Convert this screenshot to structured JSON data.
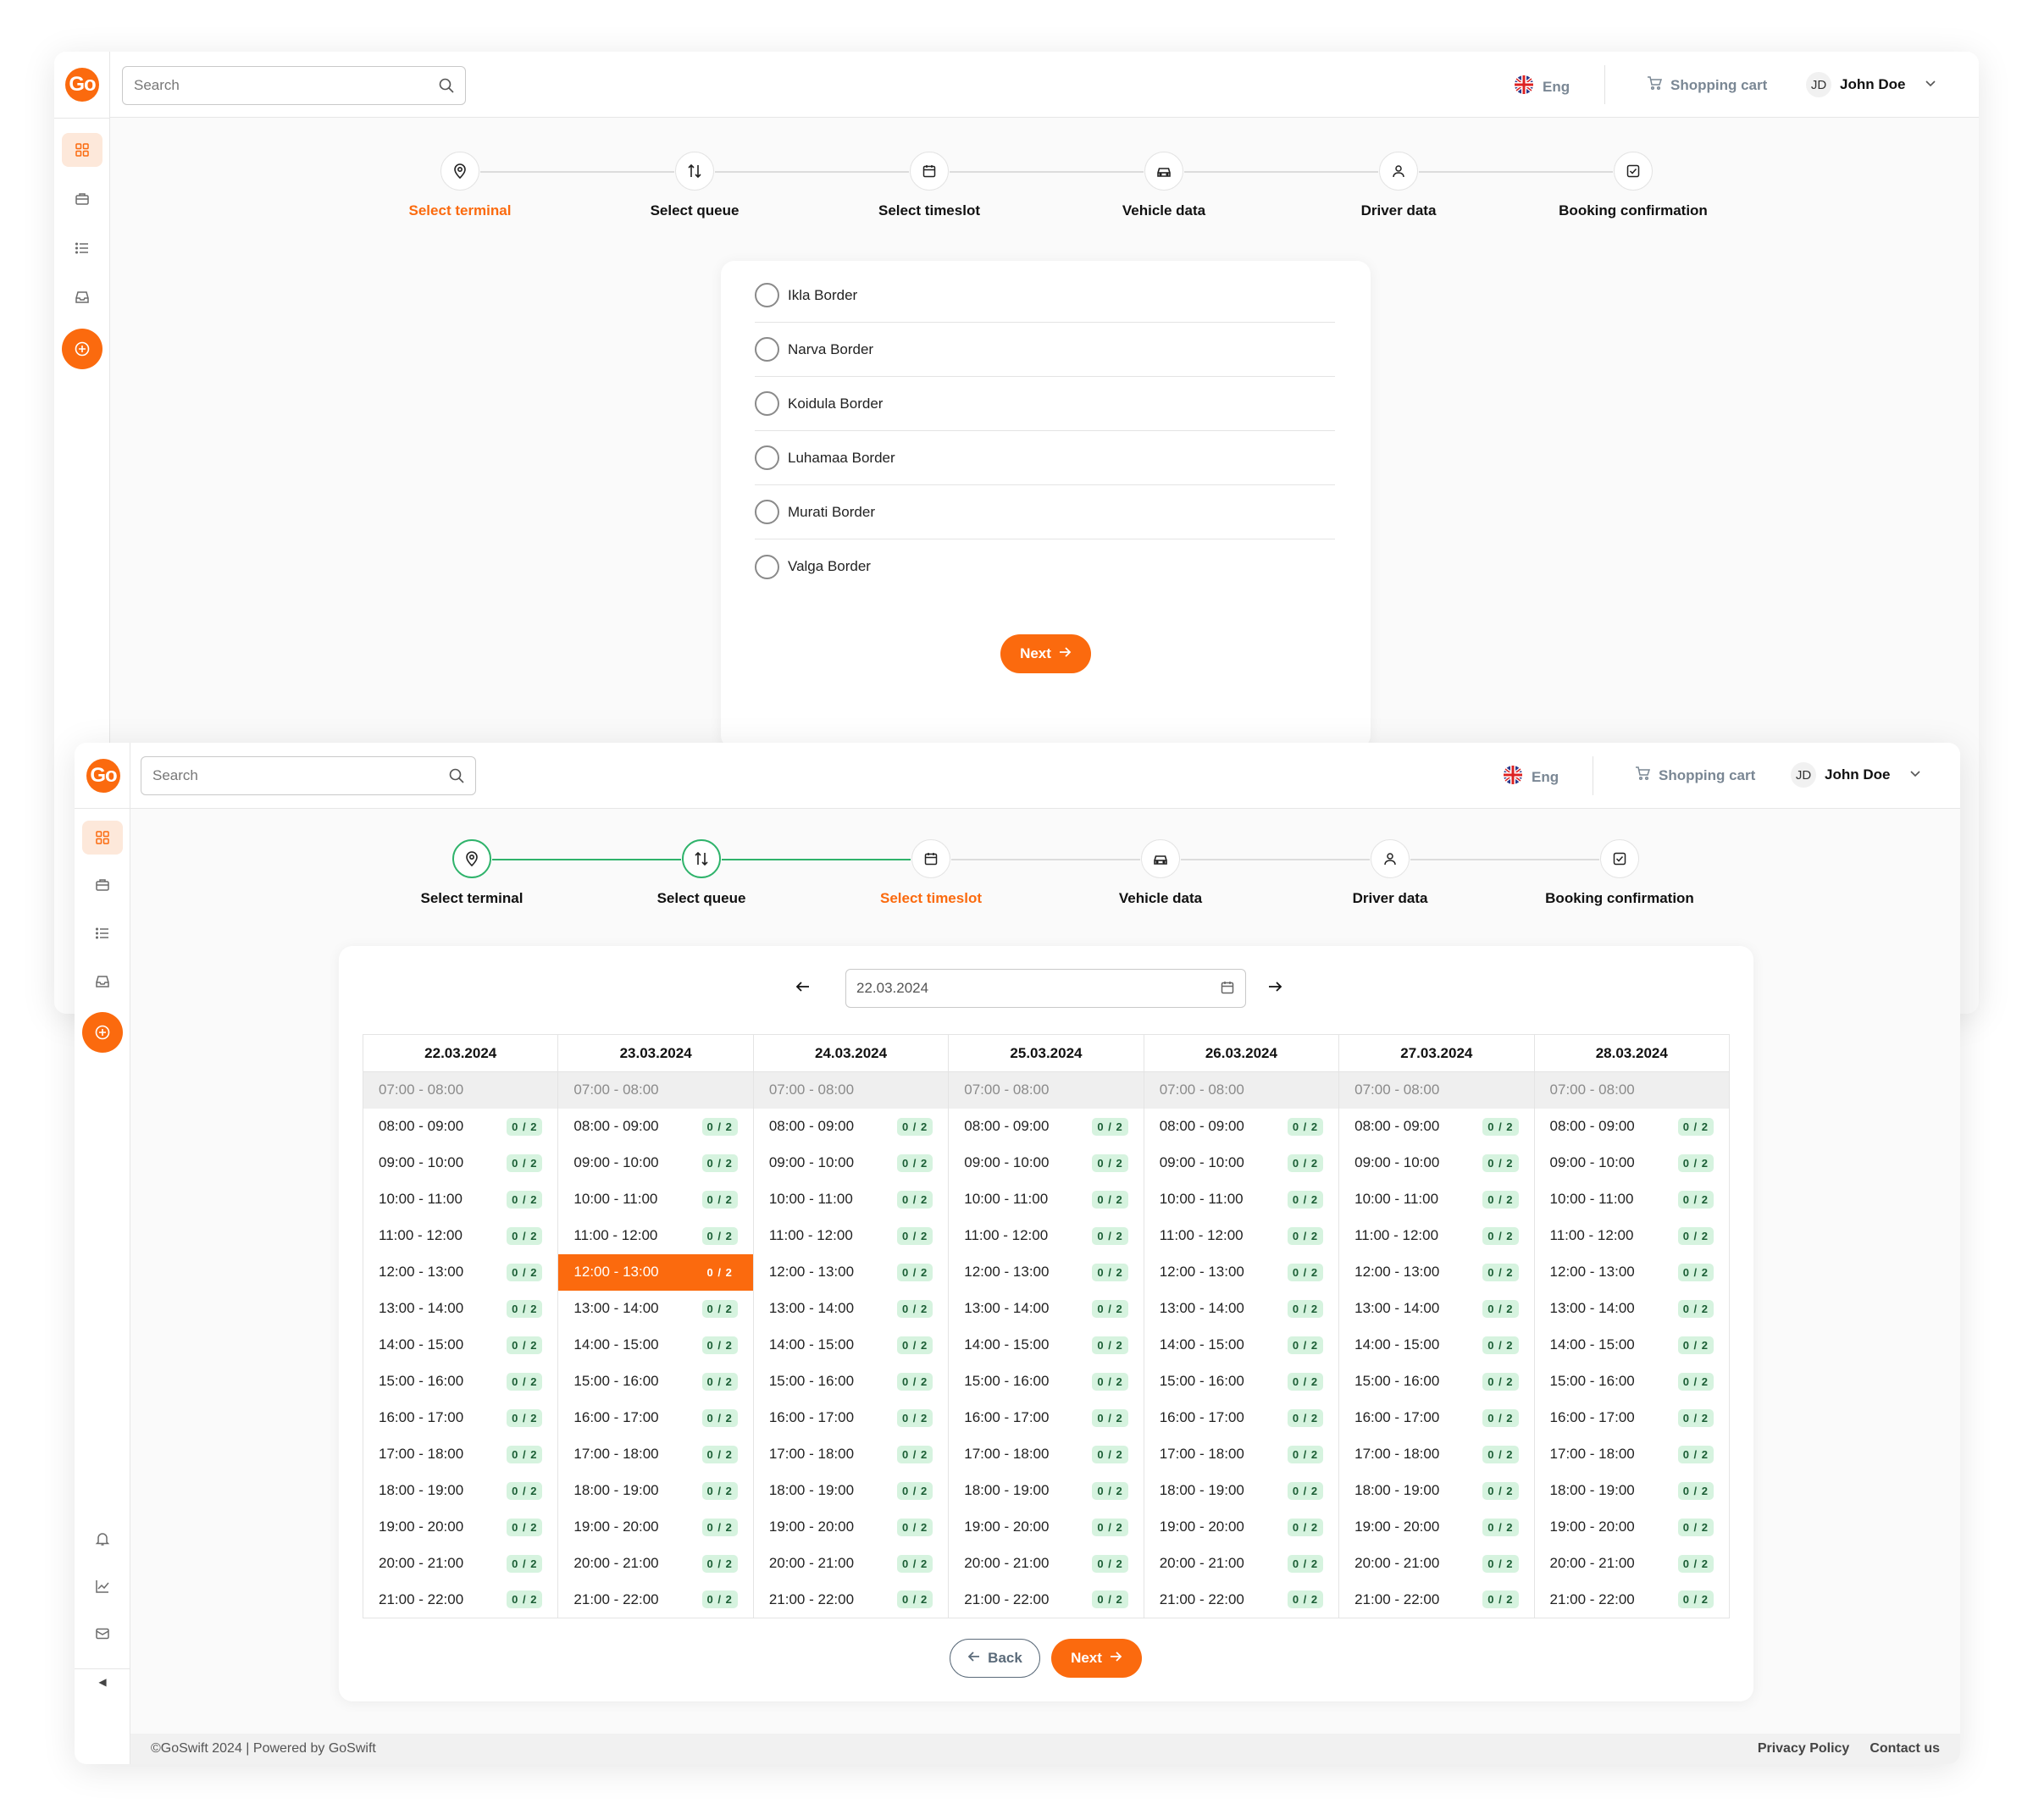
{
  "brand": {
    "logo_text": "Go",
    "accent": "#fb6a0e",
    "success": "#2fb36b"
  },
  "topbar": {
    "search_placeholder": "Search",
    "language": "Eng",
    "cart": "Shopping cart",
    "user_initials": "JD",
    "user_name": "John Doe"
  },
  "sidebar": {
    "items": [
      "dashboard-icon",
      "briefcase-icon",
      "list-icon",
      "inbox-icon",
      "add-icon"
    ],
    "bottom_items": [
      "bell-icon",
      "chart-icon",
      "mail-icon"
    ]
  },
  "steps": [
    {
      "label": "Select terminal",
      "icon": "map-pin-icon"
    },
    {
      "label": "Select queue",
      "icon": "sort-arrows-icon"
    },
    {
      "label": "Select timeslot",
      "icon": "calendar-icon"
    },
    {
      "label": "Vehicle data",
      "icon": "car-icon"
    },
    {
      "label": "Driver data",
      "icon": "user-icon"
    },
    {
      "label": "Booking confirmation",
      "icon": "checkbox-icon"
    }
  ],
  "terminal_screen": {
    "active_step": 0,
    "terminals": [
      "Ikla Border",
      "Narva Border",
      "Koidula Border",
      "Luhamaa Border",
      "Murati Border",
      "Valga Border"
    ],
    "next_label": "Next"
  },
  "timeslot_screen": {
    "active_step": 2,
    "date_value": "22.03.2024",
    "dates": [
      "22.03.2024",
      "23.03.2024",
      "24.03.2024",
      "25.03.2024",
      "26.03.2024",
      "27.03.2024",
      "28.03.2024"
    ],
    "disabled_slot": "07:00 - 08:00",
    "slots": [
      "08:00 - 09:00",
      "09:00 - 10:00",
      "10:00 - 11:00",
      "11:00 - 12:00",
      "12:00 - 13:00",
      "13:00 - 14:00",
      "14:00 - 15:00",
      "15:00 - 16:00",
      "16:00 - 17:00",
      "17:00 - 18:00",
      "18:00 - 19:00",
      "19:00 - 20:00",
      "20:00 - 21:00",
      "21:00 - 22:00"
    ],
    "capacity": "0 / 2",
    "selected": {
      "date": "23.03.2024",
      "slot": "12:00 - 13:00"
    },
    "back_label": "Back",
    "next_label": "Next"
  },
  "footer": {
    "copyright": "©GoSwift 2024 | Powered by GoSwift",
    "privacy": "Privacy Policy",
    "contact": "Contact us"
  }
}
